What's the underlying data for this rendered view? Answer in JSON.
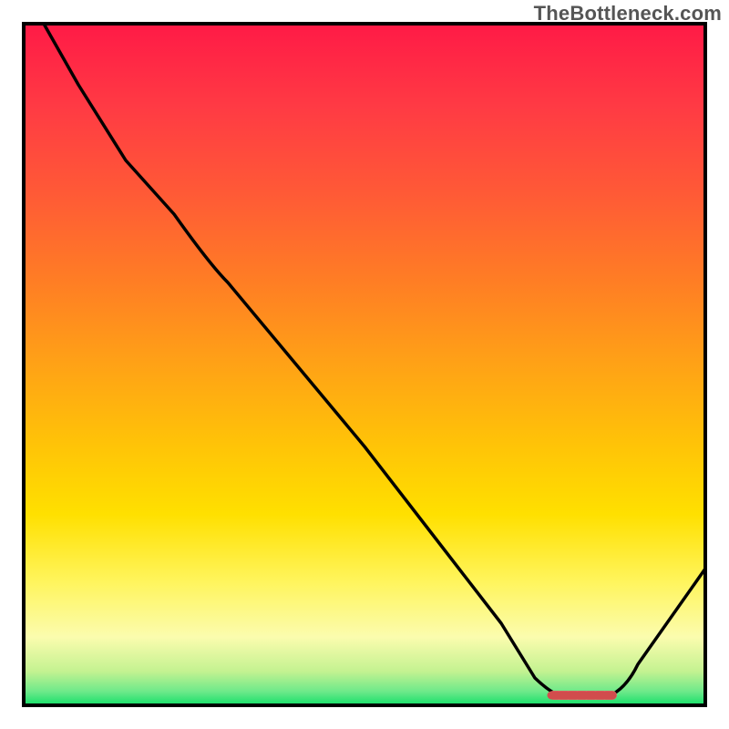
{
  "watermark": "TheBottleneck.com",
  "chart_data": {
    "type": "line",
    "title": "",
    "xlabel": "",
    "ylabel": "",
    "xlim": [
      0,
      100
    ],
    "ylim": [
      0,
      100
    ],
    "grid": false,
    "legend": false,
    "series": [
      {
        "name": "bottleneck-curve",
        "x": [
          3,
          8,
          15,
          22,
          30,
          40,
          50,
          60,
          70,
          75,
          80,
          85,
          90,
          100
        ],
        "y": [
          100,
          91,
          80,
          72,
          62,
          50,
          38,
          25,
          12,
          4,
          1,
          1,
          6,
          20
        ]
      }
    ],
    "highlight_region": {
      "name": "optimal-range",
      "x_start": 77,
      "x_end": 87,
      "y": 1.5
    },
    "background_gradient": {
      "stops": [
        {
          "pos": 0.0,
          "color": "#ff1a46"
        },
        {
          "pos": 0.15,
          "color": "#ff4040"
        },
        {
          "pos": 0.3,
          "color": "#ff6a2a"
        },
        {
          "pos": 0.45,
          "color": "#ff9a1a"
        },
        {
          "pos": 0.6,
          "color": "#ffcante00"
        },
        {
          "pos": 0.7,
          "color": "#ffe100"
        },
        {
          "pos": 0.8,
          "color": "#fff35a"
        },
        {
          "pos": 0.88,
          "color": "#fdfda0"
        },
        {
          "pos": 0.94,
          "color": "#c8f58a"
        },
        {
          "pos": 1.0,
          "color": "#16e06a"
        }
      ]
    }
  }
}
